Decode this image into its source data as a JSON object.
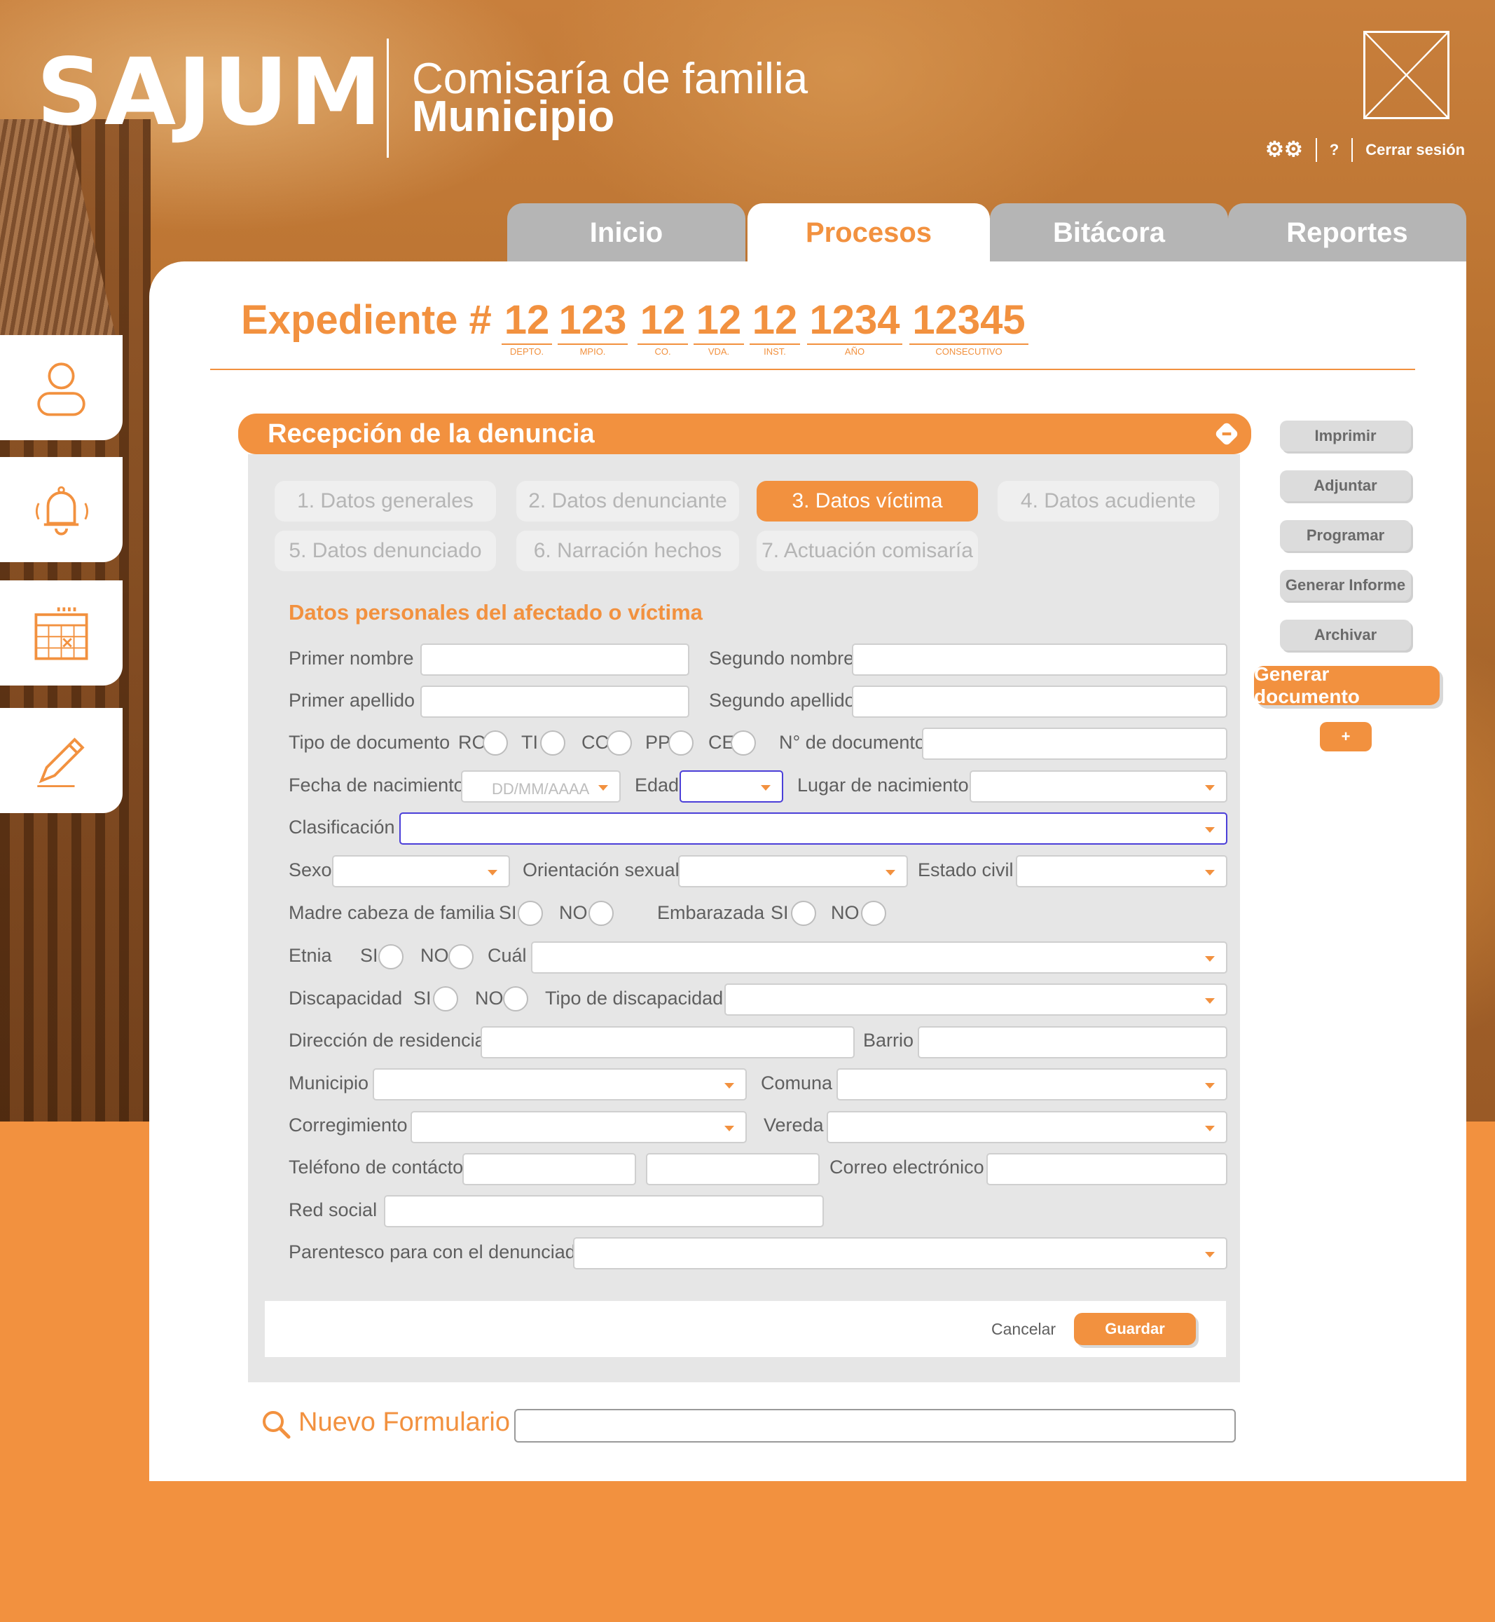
{
  "header": {
    "logo": "SAJUM",
    "org_line1": "Comisaría de familia",
    "org_line2": "Municipio",
    "help": "?",
    "logout": "Cerrar sesión"
  },
  "tabs": [
    {
      "label": "Inicio"
    },
    {
      "label": "Procesos",
      "active": true
    },
    {
      "label": "Bitácora"
    },
    {
      "label": "Reportes"
    }
  ],
  "sidebar": [
    "user-icon",
    "bell-icon",
    "calendar-icon",
    "pencil-icon"
  ],
  "expediente": {
    "title": "Expediente #",
    "parts": [
      {
        "value": "12",
        "caption": "DEPTO."
      },
      {
        "value": "123",
        "caption": "MPIO."
      },
      {
        "value": "12",
        "caption": "CO."
      },
      {
        "value": "12",
        "caption": "VDA."
      },
      {
        "value": "12",
        "caption": "INST."
      },
      {
        "value": "1234",
        "caption": "AÑO"
      },
      {
        "value": "12345",
        "caption": "CONSECUTIVO"
      }
    ]
  },
  "section": {
    "title": "Recepción de la denuncia"
  },
  "steps": [
    {
      "label": "1. Datos generales"
    },
    {
      "label": "2. Datos denunciante"
    },
    {
      "label": "3. Datos víctima",
      "active": true
    },
    {
      "label": "4. Datos acudiente"
    },
    {
      "label": "5. Datos denunciado"
    },
    {
      "label": "6. Narración hechos"
    },
    {
      "label": "7. Actuación comisaría"
    }
  ],
  "form": {
    "subtitle": "Datos personales del afectado o víctima",
    "primer_nombre": "Primer nombre",
    "segundo_nombre": "Segundo nombre",
    "primer_apellido": "Primer apellido",
    "segundo_apellido": "Segundo apellido",
    "tipo_documento": "Tipo de documento",
    "doc_rc": "RC",
    "doc_ti": "TI",
    "doc_cc": "CC",
    "doc_pp": "PP",
    "doc_ce": "CE",
    "numero_documento": "N° de documento",
    "fecha_nacimiento": "Fecha de nacimiento",
    "fecha_placeholder": "DD/MM/AAAA",
    "edad": "Edad",
    "lugar_nacimiento": "Lugar de nacimiento",
    "clasificacion": "Clasificación",
    "sexo": "Sexo",
    "orientacion_sexual": "Orientación sexual",
    "estado_civil": "Estado civil",
    "madre_cabeza": "Madre cabeza de familia",
    "embarazada": "Embarazada",
    "si": "SI",
    "no": "NO",
    "etnia": "Etnia",
    "cual": "Cuál",
    "discapacidad": "Discapacidad",
    "tipo_discapacidad": "Tipo de discapacidad",
    "direccion": "Dirección de residencia",
    "barrio": "Barrio",
    "municipio": "Municipio",
    "comuna": "Comuna",
    "corregimiento": "Corregimiento",
    "vereda": "Vereda",
    "telefono": "Teléfono de contácto",
    "correo": "Correo electrónico",
    "red_social": "Red social",
    "parentesco": "Parentesco para con el denunciado"
  },
  "actions": {
    "cancel": "Cancelar",
    "save": "Guardar"
  },
  "side_actions": [
    "Imprimir",
    "Adjuntar",
    "Programar",
    "Generar Informe",
    "Archivar"
  ],
  "generate_doc": "Generar documento",
  "add": "+",
  "new_form": {
    "label": "Nuevo Formulario",
    "value": ""
  },
  "colors": {
    "accent": "#f2913f",
    "panel": "#e6e6e6",
    "tab_inactive": "#b5b5b5",
    "focus": "#4b3fd8"
  }
}
